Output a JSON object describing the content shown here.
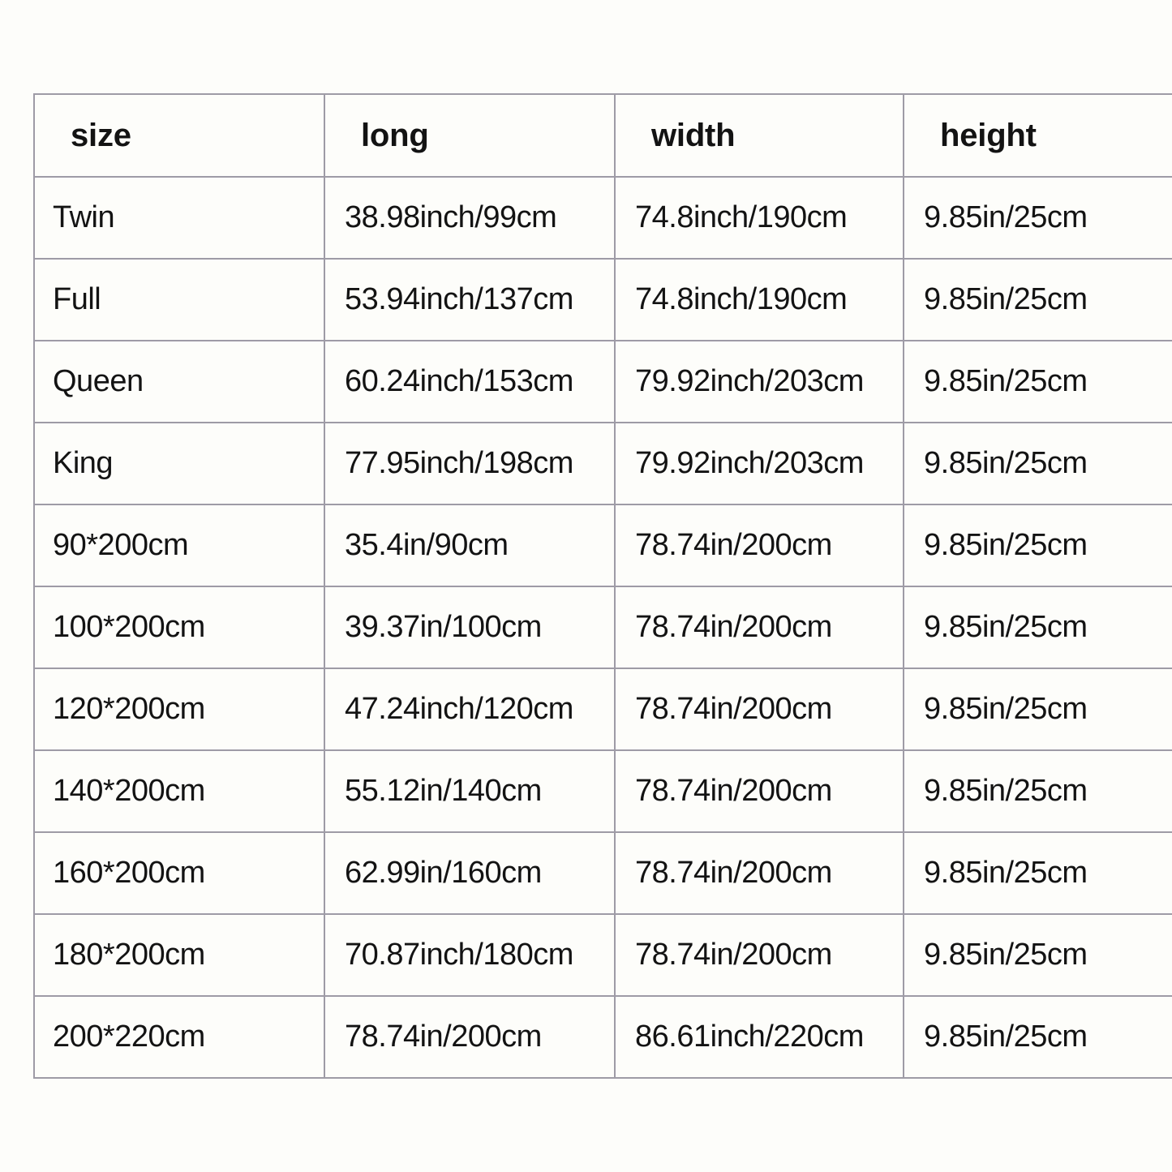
{
  "table": {
    "title": "size",
    "columns": [
      {
        "key": "size",
        "label": "size"
      },
      {
        "key": "long",
        "label": "long"
      },
      {
        "key": "width",
        "label": "width"
      },
      {
        "key": "height",
        "label": "height"
      }
    ],
    "rows": [
      {
        "size": "Twin",
        "long": "38.98inch/99cm",
        "width": "74.8inch/190cm",
        "height": "9.85in/25cm"
      },
      {
        "size": "Full",
        "long": "53.94inch/137cm",
        "width": "74.8inch/190cm",
        "height": "9.85in/25cm"
      },
      {
        "size": "Queen",
        "long": "60.24inch/153cm",
        "width": "79.92inch/203cm",
        "height": "9.85in/25cm"
      },
      {
        "size": "King",
        "long": "77.95inch/198cm",
        "width": "79.92inch/203cm",
        "height": "9.85in/25cm"
      },
      {
        "size": "90*200cm",
        "long": "35.4in/90cm",
        "width": "78.74in/200cm",
        "height": "9.85in/25cm"
      },
      {
        "size": "100*200cm",
        "long": "39.37in/100cm",
        "width": "78.74in/200cm",
        "height": "9.85in/25cm"
      },
      {
        "size": "120*200cm",
        "long": "47.24inch/120cm",
        "width": "78.74in/200cm",
        "height": "9.85in/25cm"
      },
      {
        "size": "140*200cm",
        "long": "55.12in/140cm",
        "width": "78.74in/200cm",
        "height": "9.85in/25cm"
      },
      {
        "size": "160*200cm",
        "long": "62.99in/160cm",
        "width": "78.74in/200cm",
        "height": "9.85in/25cm"
      },
      {
        "size": "180*200cm",
        "long": "70.87inch/180cm",
        "width": "78.74in/200cm",
        "height": "9.85in/25cm"
      },
      {
        "size": "200*220cm",
        "long": "78.74in/200cm",
        "width": "86.61inch/220cm",
        "height": "9.85in/25cm"
      }
    ]
  },
  "colors": {
    "page_background": "#fdfdfa",
    "cell_background": "#fdfdfa",
    "border": "#9e9ba6",
    "text": "#131313"
  }
}
